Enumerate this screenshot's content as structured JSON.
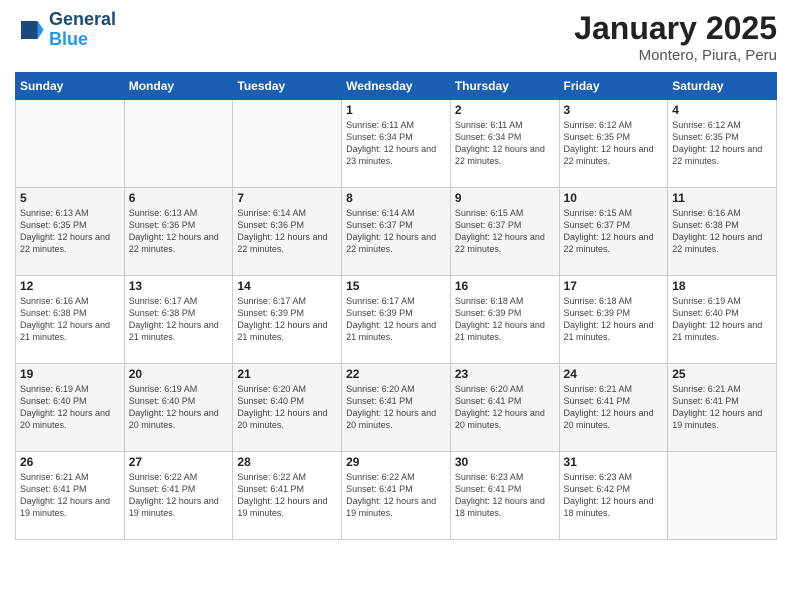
{
  "header": {
    "logo_line1": "General",
    "logo_line2": "Blue",
    "month": "January 2025",
    "location": "Montero, Piura, Peru"
  },
  "weekdays": [
    "Sunday",
    "Monday",
    "Tuesday",
    "Wednesday",
    "Thursday",
    "Friday",
    "Saturday"
  ],
  "weeks": [
    [
      {
        "day": "",
        "content": ""
      },
      {
        "day": "",
        "content": ""
      },
      {
        "day": "",
        "content": ""
      },
      {
        "day": "1",
        "content": "Sunrise: 6:11 AM\nSunset: 6:34 PM\nDaylight: 12 hours\nand 23 minutes."
      },
      {
        "day": "2",
        "content": "Sunrise: 6:11 AM\nSunset: 6:34 PM\nDaylight: 12 hours\nand 22 minutes."
      },
      {
        "day": "3",
        "content": "Sunrise: 6:12 AM\nSunset: 6:35 PM\nDaylight: 12 hours\nand 22 minutes."
      },
      {
        "day": "4",
        "content": "Sunrise: 6:12 AM\nSunset: 6:35 PM\nDaylight: 12 hours\nand 22 minutes."
      }
    ],
    [
      {
        "day": "5",
        "content": "Sunrise: 6:13 AM\nSunset: 6:35 PM\nDaylight: 12 hours\nand 22 minutes."
      },
      {
        "day": "6",
        "content": "Sunrise: 6:13 AM\nSunset: 6:36 PM\nDaylight: 12 hours\nand 22 minutes."
      },
      {
        "day": "7",
        "content": "Sunrise: 6:14 AM\nSunset: 6:36 PM\nDaylight: 12 hours\nand 22 minutes."
      },
      {
        "day": "8",
        "content": "Sunrise: 6:14 AM\nSunset: 6:37 PM\nDaylight: 12 hours\nand 22 minutes."
      },
      {
        "day": "9",
        "content": "Sunrise: 6:15 AM\nSunset: 6:37 PM\nDaylight: 12 hours\nand 22 minutes."
      },
      {
        "day": "10",
        "content": "Sunrise: 6:15 AM\nSunset: 6:37 PM\nDaylight: 12 hours\nand 22 minutes."
      },
      {
        "day": "11",
        "content": "Sunrise: 6:16 AM\nSunset: 6:38 PM\nDaylight: 12 hours\nand 22 minutes."
      }
    ],
    [
      {
        "day": "12",
        "content": "Sunrise: 6:16 AM\nSunset: 6:38 PM\nDaylight: 12 hours\nand 21 minutes."
      },
      {
        "day": "13",
        "content": "Sunrise: 6:17 AM\nSunset: 6:38 PM\nDaylight: 12 hours\nand 21 minutes."
      },
      {
        "day": "14",
        "content": "Sunrise: 6:17 AM\nSunset: 6:39 PM\nDaylight: 12 hours\nand 21 minutes."
      },
      {
        "day": "15",
        "content": "Sunrise: 6:17 AM\nSunset: 6:39 PM\nDaylight: 12 hours\nand 21 minutes."
      },
      {
        "day": "16",
        "content": "Sunrise: 6:18 AM\nSunset: 6:39 PM\nDaylight: 12 hours\nand 21 minutes."
      },
      {
        "day": "17",
        "content": "Sunrise: 6:18 AM\nSunset: 6:39 PM\nDaylight: 12 hours\nand 21 minutes."
      },
      {
        "day": "18",
        "content": "Sunrise: 6:19 AM\nSunset: 6:40 PM\nDaylight: 12 hours\nand 21 minutes."
      }
    ],
    [
      {
        "day": "19",
        "content": "Sunrise: 6:19 AM\nSunset: 6:40 PM\nDaylight: 12 hours\nand 20 minutes."
      },
      {
        "day": "20",
        "content": "Sunrise: 6:19 AM\nSunset: 6:40 PM\nDaylight: 12 hours\nand 20 minutes."
      },
      {
        "day": "21",
        "content": "Sunrise: 6:20 AM\nSunset: 6:40 PM\nDaylight: 12 hours\nand 20 minutes."
      },
      {
        "day": "22",
        "content": "Sunrise: 6:20 AM\nSunset: 6:41 PM\nDaylight: 12 hours\nand 20 minutes."
      },
      {
        "day": "23",
        "content": "Sunrise: 6:20 AM\nSunset: 6:41 PM\nDaylight: 12 hours\nand 20 minutes."
      },
      {
        "day": "24",
        "content": "Sunrise: 6:21 AM\nSunset: 6:41 PM\nDaylight: 12 hours\nand 20 minutes."
      },
      {
        "day": "25",
        "content": "Sunrise: 6:21 AM\nSunset: 6:41 PM\nDaylight: 12 hours\nand 19 minutes."
      }
    ],
    [
      {
        "day": "26",
        "content": "Sunrise: 6:21 AM\nSunset: 6:41 PM\nDaylight: 12 hours\nand 19 minutes."
      },
      {
        "day": "27",
        "content": "Sunrise: 6:22 AM\nSunset: 6:41 PM\nDaylight: 12 hours\nand 19 minutes."
      },
      {
        "day": "28",
        "content": "Sunrise: 6:22 AM\nSunset: 6:41 PM\nDaylight: 12 hours\nand 19 minutes."
      },
      {
        "day": "29",
        "content": "Sunrise: 6:22 AM\nSunset: 6:41 PM\nDaylight: 12 hours\nand 19 minutes."
      },
      {
        "day": "30",
        "content": "Sunrise: 6:23 AM\nSunset: 6:41 PM\nDaylight: 12 hours\nand 18 minutes."
      },
      {
        "day": "31",
        "content": "Sunrise: 6:23 AM\nSunset: 6:42 PM\nDaylight: 12 hours\nand 18 minutes."
      },
      {
        "day": "",
        "content": ""
      }
    ]
  ]
}
